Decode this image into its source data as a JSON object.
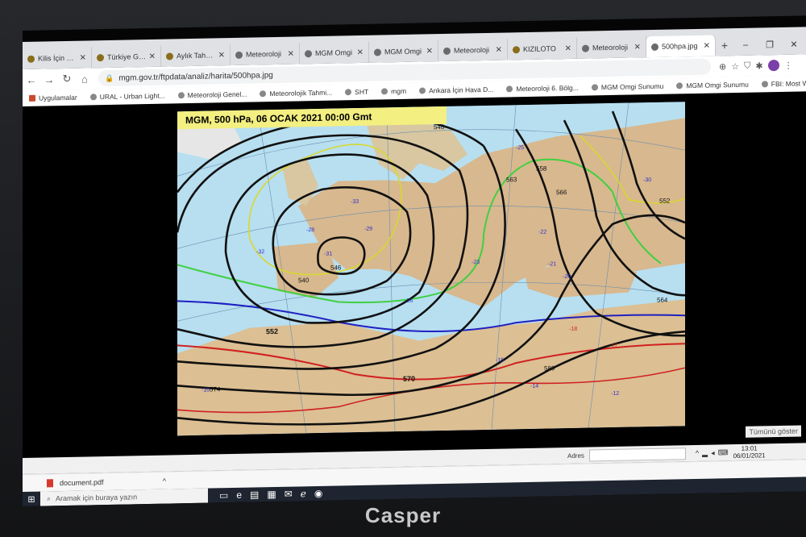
{
  "tabs": [
    {
      "label": "Kilis İçin Hava",
      "active": false
    },
    {
      "label": "Türkiye Geneli",
      "active": false
    },
    {
      "label": "Aylık Tahmin",
      "active": false
    },
    {
      "label": "Meteoroloji",
      "active": false
    },
    {
      "label": "MGM Omgi",
      "active": false
    },
    {
      "label": "MGM Omgi",
      "active": false
    },
    {
      "label": "Meteoroloji",
      "active": false
    },
    {
      "label": "KIZILOTO",
      "active": false
    },
    {
      "label": "Meteoroloji",
      "active": false
    },
    {
      "label": "500hpa.jpg",
      "active": true
    }
  ],
  "toolbar": {
    "url": "mgm.gov.tr/ftpdata/analiz/harita/500hpa.jpg"
  },
  "bookmarks": [
    "Uygulamalar",
    "URAL - Urban Light...",
    "Meteoroloji Genel...",
    "Meteorolojik Tahmi...",
    "SHT",
    "mgm",
    "Ankara İçin Hava D...",
    "Meteoroloji 6. Bölg...",
    "MGM Omgi Sunumu",
    "MGM Omgi Sunumu",
    "FBI: Most Wanted: I..."
  ],
  "map": {
    "title": "MGM, 500 hPa,  06 OCAK 2021 00:00 Gmt",
    "contour_labels": [
      "552",
      "570",
      "574",
      "564",
      "558",
      "546",
      "540",
      "552",
      "580",
      "548",
      "563",
      "566"
    ],
    "station_temps": [
      "-32",
      "-29",
      "-33",
      "-26",
      "-25",
      "-21",
      "-22",
      "-20",
      "-17",
      "-14",
      "-12",
      "-10",
      "-30",
      "-28",
      "-31",
      "-23",
      "-18",
      "-15"
    ],
    "colors": {
      "sea": "#b7dff0",
      "land": "#d8b88e",
      "contour": "#111111",
      "isotherm_red": "#d02020",
      "isotherm_blue": "#2020c0",
      "isotherm_green": "#40d040",
      "isotherm_yellow": "#d8d830"
    }
  },
  "translate_label": "Tümünü göster",
  "status": {
    "address_label": "Adres",
    "time": "13:01",
    "date": "06/01/2021"
  },
  "download": {
    "filename": "document.pdf"
  },
  "taskbar": {
    "search_placeholder": "Aramak için buraya yazın"
  },
  "brand": "Casper"
}
